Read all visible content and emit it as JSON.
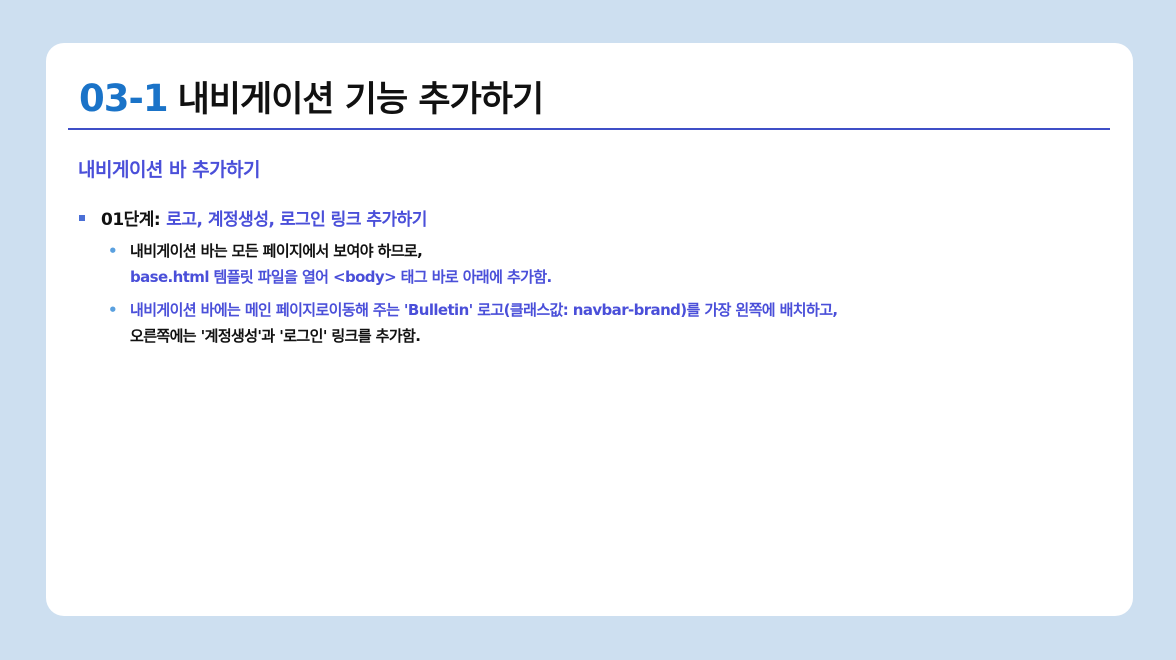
{
  "title": {
    "number": "03-1",
    "text": "내비게이션 기능 추가하기"
  },
  "section_heading": "내비게이션 바 추가하기",
  "step": {
    "prefix": "01단계:",
    "text": "로고, 계정생성, 로그인 링크 추가하기"
  },
  "bullets": [
    {
      "line1": "내비게이션 바는 모든 페이지에서 보여야 하므로,",
      "line2": "base.html 템플릿 파일을 열어 <body> 태그 바로 아래에 추가함."
    },
    {
      "line1": "내비게이션 바에는 메인 페이지로이동해 주는 'Bulletin' 로고(클래스값: navbar-brand)를 가장 왼쪽에 배치하고,",
      "line2": "오른쪽에는 '계정생성'과 '로그인' 링크를 추가함."
    }
  ],
  "colors": {
    "background": "#cddff0",
    "title_number": "#1a73c8",
    "accent": "#4a4fd9",
    "rule": "#3f4fc7"
  }
}
